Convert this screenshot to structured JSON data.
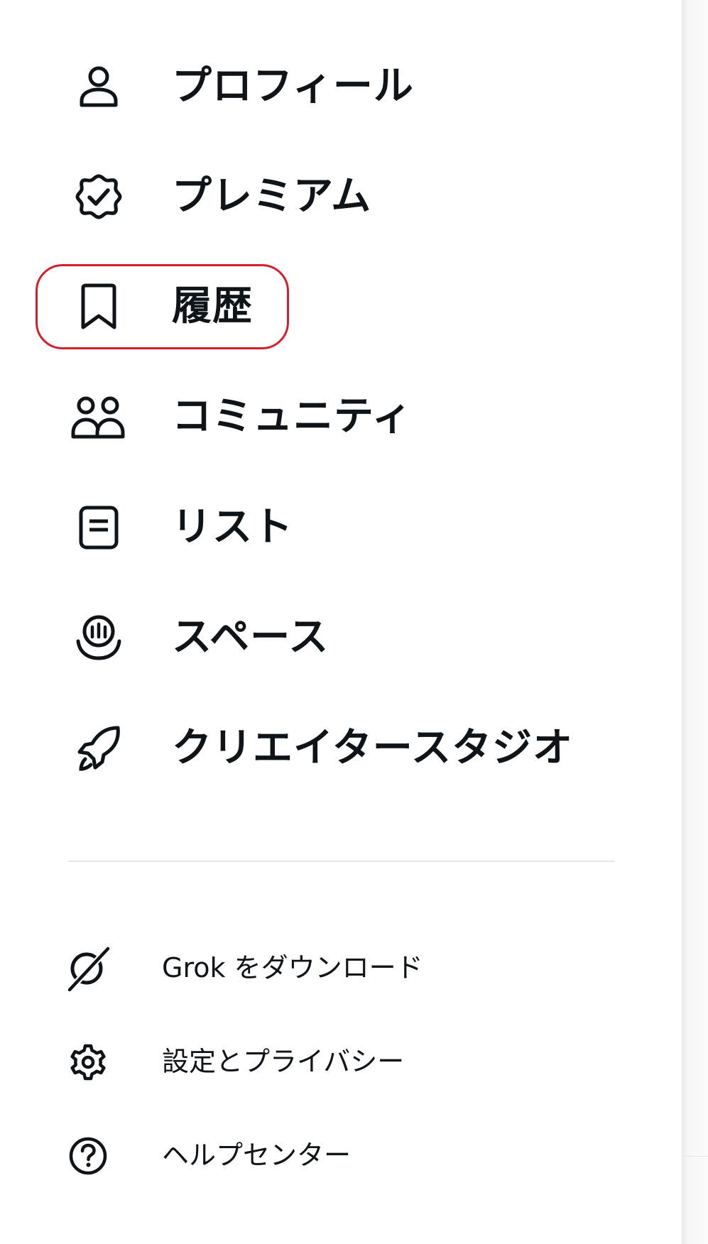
{
  "menu": {
    "items": [
      {
        "label": "プロフィール",
        "icon": "person-icon"
      },
      {
        "label": "プレミアム",
        "icon": "verified-badge-icon"
      },
      {
        "label": "履歴",
        "icon": "bookmark-icon",
        "highlighted": true
      },
      {
        "label": "コミュニティ",
        "icon": "people-icon"
      },
      {
        "label": "リスト",
        "icon": "list-icon"
      },
      {
        "label": "スペース",
        "icon": "spaces-microphone-icon"
      },
      {
        "label": "クリエイタースタジオ",
        "icon": "rocket-icon"
      }
    ],
    "secondary": [
      {
        "label": "Grok をダウンロード",
        "icon": "grok-icon"
      },
      {
        "label": "設定とプライバシー",
        "icon": "gear-icon"
      },
      {
        "label": "ヘルプセンター",
        "icon": "help-icon"
      }
    ]
  },
  "colors": {
    "text": "#0f1419",
    "highlight_ring": "#d4202c",
    "divider": "#e6e8ea"
  }
}
